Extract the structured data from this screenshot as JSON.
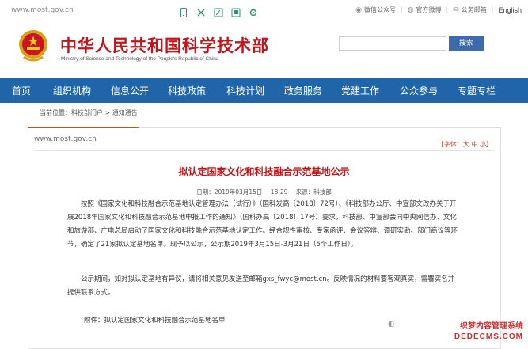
{
  "topbar": {
    "site_url": "www.most.gov.cn",
    "icons": [
      "mobile-icon",
      "share-icon",
      "edit-icon",
      "tablet-icon",
      "settings-icon"
    ],
    "links": {
      "wechat": "微信公众号",
      "weibo": "官方微博",
      "email": "公务邮箱",
      "english": "English"
    }
  },
  "header": {
    "title_cn": "中华人民共和国科学技术部",
    "title_en": "Ministry of Science and Technology of the People's Republic of China",
    "search": {
      "placeholder": "",
      "button": "搜索"
    }
  },
  "nav": {
    "items": [
      "首页",
      "组织机构",
      "信息公开",
      "科技政策",
      "科技计划",
      "政务服务",
      "党建工作",
      "公众参与",
      "专题专栏"
    ]
  },
  "breadcrumb": "当前位置：科技部门户 > 通知通告",
  "panel": {
    "site_url": "www.most.gov.cn",
    "font_control": "【字体：大 中 小】"
  },
  "article": {
    "title": "拟认定国家文化和科技融合示范基地公示",
    "date": "日期：2019年03月15日",
    "time": "18:29",
    "source": "来源：科技部",
    "paragraph1": "按照《国家文化和科技融合示范基地认定管理办法（试行）》（国科发高〔2018〕72号）、《科技部办公厅、中宣部文改办关于开展2018年国家文化和科技融合示范基地申报工作的通知》（国科办高〔2018〕17号）要求，科技部、中宣部会同中央网信办、文化和旅游部、广电总局启动了国家文化和科技融合示范基地认定工作。经合规性审核、专家函评、会议答辩、调研实勘、部门商议等环节，确定了21家拟认定基地名单。现予以公示，公示期2019年3月15日-3月21日（5个工作日）。",
    "paragraph2": "公示期间，如对拟认定基地有异议，请将相关意见发送至邮箱gxs_fwyc@most.cn。反映情况的材料要客观真实，需署实名并提供联系方式。",
    "attachment": "附件：拟认定国家文化和科技融合示范基地名单"
  },
  "watermark": {
    "line1": "织梦内容管理系统",
    "line2": "DEDECMS.COM"
  },
  "colors": {
    "brand_red": "#c0161b",
    "nav_blue": "#1f65a7",
    "accent_orange": "#b85a19"
  }
}
